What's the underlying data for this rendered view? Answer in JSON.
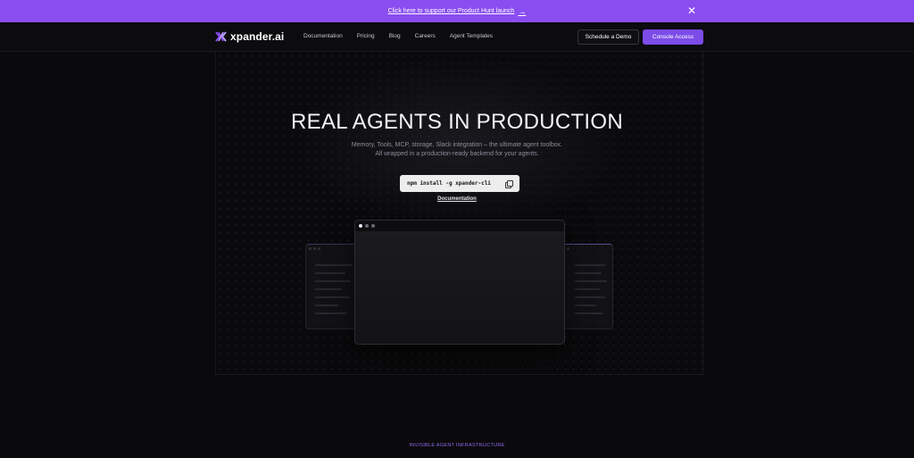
{
  "banner": {
    "text": "Click here to support our Product Hunt launch",
    "arrow_icon": "arrow-right-icon",
    "close_icon": "close-icon"
  },
  "nav": {
    "logo_text": "xpander.ai",
    "links": [
      "Documentation",
      "Pricing",
      "Blog",
      "Careers",
      "Agent Templates"
    ],
    "schedule_demo": "Schedule a Demo",
    "console_access": "Console Access"
  },
  "hero": {
    "title": "REAL AGENTS IN PRODUCTION",
    "subtitle_line1": "Memory, Tools, MCP, storage, Slack integration – the ultimate agent toolbox.",
    "subtitle_line2": "All wrapped in a production-ready backend for your agents.",
    "install_command": "npm install -g xpander-cli",
    "documentation_link": "Documentation"
  },
  "section": {
    "eyebrow": "INVISIBLE AGENT INFRASTRUCTURE"
  },
  "colors": {
    "accent": "#8a4ef0",
    "button": "#7c4ce8",
    "background": "#0a090b"
  }
}
